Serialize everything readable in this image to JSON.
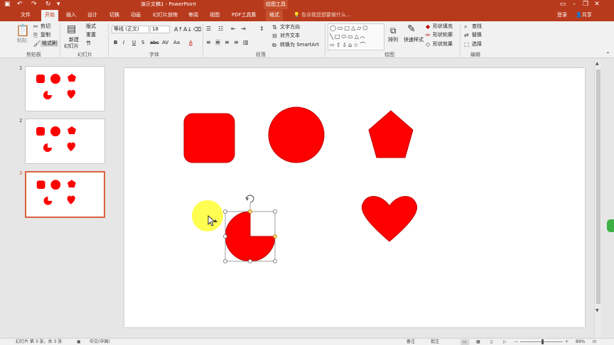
{
  "app": {
    "window_title": "演示文稿1 - PowerPoint",
    "context_tab_title": "绘图工具",
    "login": "登录",
    "share": "共享",
    "tell_me": "告诉我您想要做什么..."
  },
  "tabs": [
    "文件",
    "开始",
    "插入",
    "设计",
    "切换",
    "动画",
    "幻灯片放映",
    "审阅",
    "视图",
    "PDF工具集",
    "格式"
  ],
  "ribbon": {
    "clipboard": {
      "paste": "粘贴",
      "cut": "剪切",
      "copy": "复制",
      "format_painter": "格式刷",
      "group": "剪贴板"
    },
    "slides": {
      "new_slide": "新建",
      "new_slide2": "幻灯片",
      "layout": "版式",
      "reset": "重置",
      "section": "节",
      "group": "幻灯片"
    },
    "font": {
      "name": "等线 (正文)",
      "size": "18",
      "group": "字体",
      "bold": "B",
      "italic": "I",
      "underline": "U",
      "shadow": "S",
      "strike": "abc",
      "spacing": "AV",
      "case": "Aa",
      "color": "A"
    },
    "paragraph": {
      "text_direction": "文字方向",
      "align_text": "对齐文本",
      "smartart": "转换为 SmartArt",
      "group": "段落"
    },
    "drawing": {
      "arrange": "排列",
      "quick_styles": "快速样式",
      "fill": "形状填充",
      "outline": "形状轮廓",
      "effects": "形状效果",
      "group": "绘图"
    },
    "editing": {
      "find": "查找",
      "replace": "替换",
      "select": "选择",
      "group": "编辑"
    }
  },
  "thumbnails": [
    {
      "number": "1",
      "selected": false
    },
    {
      "number": "2",
      "selected": false
    },
    {
      "number": "3",
      "selected": true
    }
  ],
  "status": {
    "slide_info": "幻灯片 第 3 张，共 3 张",
    "language": "中文(中国)",
    "notes": "备注",
    "comments": "批注",
    "zoom": "89%"
  },
  "colors": {
    "accent": "#b83a1d",
    "shape_fill": "#ff0000",
    "shape_stroke": "#c00000",
    "cursor_highlight": "#ffff33"
  },
  "icons": [
    "undo-icon",
    "redo-icon",
    "save-icon",
    "paste-icon",
    "cut-icon",
    "copy-icon",
    "format-painter-icon",
    "rotate-handle-icon",
    "mouse-cursor-icon",
    "search-icon",
    "share-icon"
  ]
}
